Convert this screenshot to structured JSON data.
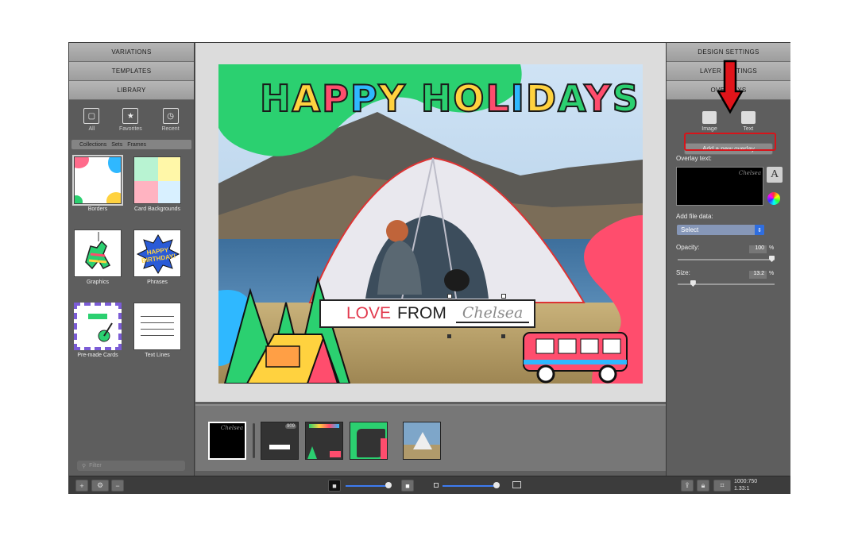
{
  "left_panel": {
    "sections": [
      "VARIATIONS",
      "TEMPLATES",
      "LIBRARY"
    ],
    "tools": [
      {
        "label": "All",
        "icon": "square-icon"
      },
      {
        "label": "Favorites",
        "icon": "star-icon"
      },
      {
        "label": "Recent",
        "icon": "clock-icon"
      }
    ],
    "breadcrumb": [
      "Collections",
      "Sets",
      "Frames"
    ],
    "tiles": [
      {
        "label": "Borders"
      },
      {
        "label": "Card Backgrounds"
      },
      {
        "label": "Graphics"
      },
      {
        "label": "Phrases"
      },
      {
        "label": "Pre-made Cards"
      },
      {
        "label": "Text Lines"
      }
    ],
    "phrases_thumb_text": "HAPPY BIRTHDAY!",
    "filter_placeholder": "Filter"
  },
  "canvas": {
    "headline_letters": [
      "H",
      "A",
      "P",
      "P",
      "Y",
      " ",
      "H",
      "O",
      "L",
      "I",
      "D",
      "A",
      "Y",
      "S"
    ],
    "headline_colors": [
      "#2bd070",
      "#ffd23f",
      "#ff4d6d",
      "#2fb8ff",
      "#ffd23f",
      "#000000",
      "#2bd070",
      "#ffd23f",
      "#ff4d6d",
      "#2fb8ff",
      "#ffd23f",
      "#2bd070",
      "#ff4d6d",
      "#2bd070"
    ],
    "banner_love": "LOVE",
    "banner_from": "FROM",
    "banner_name": "Chelsea"
  },
  "filmstrip": {
    "thumb1_text": "Chelsea",
    "thumb_badge": "909"
  },
  "right_panel": {
    "sections": [
      "DESIGN SETTINGS",
      "LAYER SETTINGS",
      "OVERLAYS"
    ],
    "tabs": [
      {
        "label": "Image"
      },
      {
        "label": "Text"
      }
    ],
    "add_overlay_label": "Add a new overlay",
    "overlay_text_label": "Overlay text:",
    "overlay_preview_text": "Chelsea",
    "file_data_label": "Add file data:",
    "select_value": "Select",
    "opacity_label": "Opacity:",
    "opacity_value": "100",
    "opacity_unit": "%",
    "size_label": "Size:",
    "size_value": "13.2",
    "size_unit": "%",
    "opacity_level": 1.0,
    "size_level": 0.13
  },
  "bottom_bar": {
    "dims_line1": "1000:750",
    "dims_line2": "1.33:1"
  },
  "colors": {
    "accent_red": "#d7141a",
    "blob_green": "#2bd070",
    "blob_pink": "#ff4d6d",
    "blob_blue": "#2fb8ff",
    "selection_blue": "#3d7bf0"
  }
}
